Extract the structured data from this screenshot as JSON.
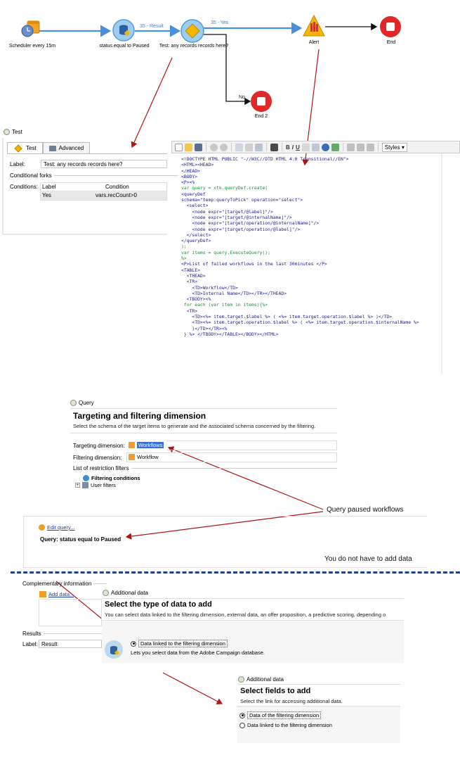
{
  "workflow": {
    "nodes": {
      "scheduler": "Scheduler every 15m",
      "status": "status equal to Paused",
      "test": "Test: any records records here?",
      "alert": "Alert",
      "end": "End",
      "end2": "End 2"
    },
    "edges": {
      "result": "35 - Result",
      "yes": "35 - Yes",
      "no": "No"
    }
  },
  "test_panel": {
    "title": "Test",
    "tabs": [
      "Test",
      "Advanced"
    ],
    "label_caption": "Label:",
    "label_value": "Test: any records records here?",
    "conditional_forks": "Conditional forks",
    "conditions_caption": "Conditions:",
    "col_label": "Label",
    "col_condition": "Condition",
    "row_label": "Yes",
    "row_condition": "vars.recCount>0"
  },
  "editor": {
    "toolbar": {
      "bold": "B",
      "italic": "I",
      "underline": "U",
      "styles": "Styles"
    },
    "code_lines": [
      "<!DOCTYPE HTML PUBLIC \"-//W3C//DTD HTML 4.0 Transitional//EN\">",
      "<HTML><HEAD>",
      "</HEAD>",
      "<BODY>",
      "<P><%",
      "var query = xtk.queryDef.create(",
      "<queryDef",
      "schema=\"temp:queryToPick\" operation=\"select\">",
      "  <select>",
      "    <node expr=\"[target/@label]\"/>",
      "    <node expr=\"[target/@internalName]\"/>",
      "    <node expr=\"[target/operation/@internalName]\"/>",
      "    <node expr=\"[target/operation/@label]\"/>",
      "  </select>",
      "</queryDef>",
      ");",
      "var items = query.ExecuteQuery();",
      "%>",
      "<P>List of failed workflows in the last 30minutes </P>",
      "<TABLE>",
      "  <THEAD>",
      "  <TR>",
      "    <TD>Workflow</TD>",
      "    <TD>Internal Name</TD></TR></THEAD>",
      "  <TBODY><%",
      " for each (var item in items){%>",
      "  <TR>",
      "    <TD><%= item.target.$label %> ( <%= item.target.operation.$label %> )</TD>",
      "    <TD><%= item.target.operation.$label %> ( <%= item.target.operation.$internalName %>",
      "    )</TD></TR><%",
      " } %> </TBODY></TABLE></BODY></HTML>"
    ]
  },
  "query_panel": {
    "title": "Query",
    "header_title": "Targeting and filtering dimension",
    "header_sub": "Select the schema of the target items to  generate and the associated schema concerned by the filtering.",
    "targeting_caption": "Targeting dimension:",
    "targeting_value": "Workflows",
    "filtering_caption": "Filtering dimension:",
    "filtering_value": "Workflow",
    "restriction_caption": "List of restriction filters",
    "filtering_conditions": "Filtering conditions",
    "user_filters": "User filters"
  },
  "target_selection": {
    "edit_query": "Edit query...",
    "query_summary": "Query: status equal to Paused"
  },
  "annotations": {
    "query_paused": "Query paused workflows",
    "no_add_data": "You do not have to add data"
  },
  "complementary": {
    "section": "Complementary information",
    "add_data": "Add data...",
    "results": "Results",
    "label_caption": "Label:",
    "label_value": "Result"
  },
  "additional_data_1": {
    "title": "Additional data",
    "header_title": "Select the type of data to add",
    "header_sub": "You can select data linked to the filtering dimension, external data, an offer proposition, a predictive scoring, depending o",
    "option": "Data linked to the filtering dimension",
    "option_desc": "Lets you select data from the Adobe Campaign database."
  },
  "additional_data_2": {
    "title": "Additional data",
    "header_title": "Select fields to add",
    "header_sub": "Select the link for accessing additional data.",
    "option_1": "Data of the filtering dimension",
    "option_2": "Data linked to the filtering dimension"
  },
  "colors": {
    "flow_blue": "#4a90d9",
    "node_circle": "#8ec4ec",
    "end_red": "#e02828",
    "arrow_red": "#b01515",
    "dashed_blue": "#1f3f99"
  }
}
